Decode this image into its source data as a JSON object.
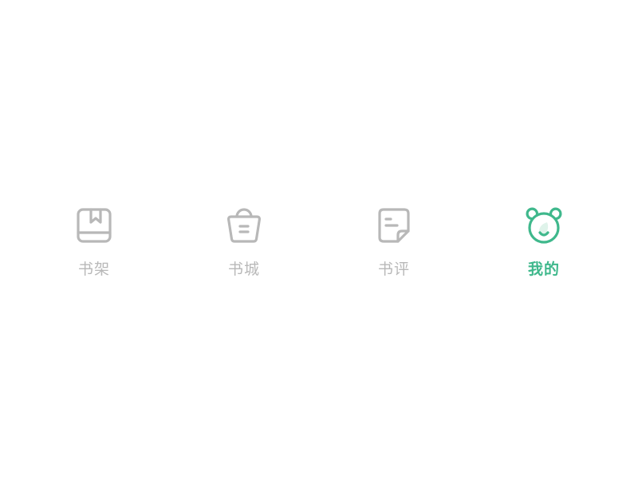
{
  "colors": {
    "inactive": "#b8b8b8",
    "active": "#3fb88c",
    "active_fill": "#dff3ea"
  },
  "tabbar": {
    "active_index": 3,
    "tabs": [
      {
        "label": "书架",
        "icon": "bookshelf-icon"
      },
      {
        "label": "书城",
        "icon": "shopping-bag-icon"
      },
      {
        "label": "书评",
        "icon": "document-icon"
      },
      {
        "label": "我的",
        "icon": "bear-face-icon"
      }
    ]
  }
}
